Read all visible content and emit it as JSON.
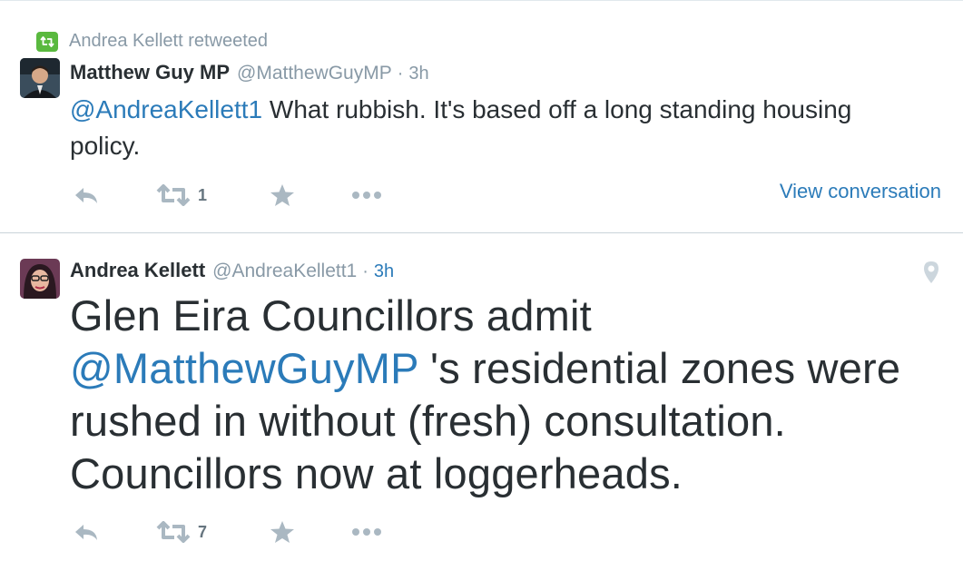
{
  "tweets": [
    {
      "retweeted_by": "Andrea Kellett retweeted",
      "author_name": "Matthew Guy MP",
      "author_handle": "@MatthewGuyMP",
      "separator": "·",
      "time": "3h",
      "mention": "@AndreaKellett1",
      "body": " What rubbish. It's based off a long standing housing policy.",
      "retweet_count": "1",
      "view_conversation": "View conversation",
      "avatar_icon": "profile-photo"
    },
    {
      "author_name": "Andrea Kellett",
      "author_handle": "@AndreaKellett1",
      "separator": "·",
      "time": "3h",
      "text_before": "Glen Eira Councillors admit ",
      "mention": "@MatthewGuyMP",
      "text_after": " 's residential zones were rushed in without (fresh) consultation. Councillors now at loggerheads.",
      "retweet_count": "7",
      "location_icon": "map-pin-icon",
      "avatar_icon": "profile-photo"
    }
  ],
  "colors": {
    "link": "#2b7bb9",
    "muted": "#8899a6",
    "action_icon": "#aab8c2",
    "retweet_green": "#5ab93f",
    "text": "#292f33"
  }
}
